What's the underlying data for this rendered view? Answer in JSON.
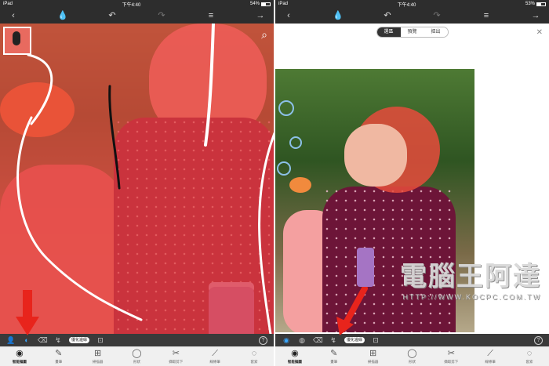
{
  "left": {
    "status": {
      "carrier": "iPad",
      "time": "下午4:40",
      "battery_pct": "54%",
      "battery_level": 0.54
    },
    "toolbar": {
      "back": "‹",
      "drop": "💧",
      "undo": "↶",
      "redo": "↷",
      "menu": "≡",
      "export": "→"
    },
    "toolrow": {
      "person": "👤",
      "active_tool": "◐",
      "eraser": "⌫",
      "brush": "↯",
      "pill": "優化邊緣",
      "crop": "⊡",
      "help": "?"
    },
    "bottombar": [
      {
        "icon": "◉",
        "label": "智能摳圖"
      },
      {
        "icon": "✎",
        "label": "畫筆"
      },
      {
        "icon": "⊞",
        "label": "掃描器"
      },
      {
        "icon": "◯",
        "label": "形狀"
      },
      {
        "icon": "✂",
        "label": "擷取剪下"
      },
      {
        "icon": "⟋",
        "label": "線條筆"
      },
      {
        "icon": "◌",
        "label": "套索"
      }
    ]
  },
  "right": {
    "status": {
      "carrier": "iPad",
      "time": "下午4:40",
      "battery_pct": "53%",
      "battery_level": 0.53
    },
    "toolbar": {
      "back": "‹",
      "drop": "💧",
      "undo": "↶",
      "redo": "↷",
      "menu": "≡",
      "export": "→"
    },
    "segments": [
      {
        "label": "選區"
      },
      {
        "label": "預覽"
      },
      {
        "label": "摳出"
      }
    ],
    "close": "✕",
    "toolrow": {
      "active_tool": "◉",
      "globe": "◍",
      "eraser": "⌫",
      "brush": "↯",
      "pill": "優化邊緣",
      "crop": "⊡",
      "help": "?"
    },
    "bottombar": [
      {
        "icon": "◉",
        "label": "智能摳圖"
      },
      {
        "icon": "✎",
        "label": "畫筆"
      },
      {
        "icon": "⊞",
        "label": "掃描器"
      },
      {
        "icon": "◯",
        "label": "形狀"
      },
      {
        "icon": "✂",
        "label": "擷取剪下"
      },
      {
        "icon": "⟋",
        "label": "線條筆"
      },
      {
        "icon": "◌",
        "label": "套索"
      }
    ],
    "watermark": {
      "title": "電腦王阿達",
      "url": "HTTP://WWW.KOCPC.COM.TW"
    }
  },
  "colors": {
    "accent": "#39a7ff",
    "overlay": "#e63c37",
    "arrow": "#e8241c",
    "toolbar": "#2d2d2d"
  }
}
